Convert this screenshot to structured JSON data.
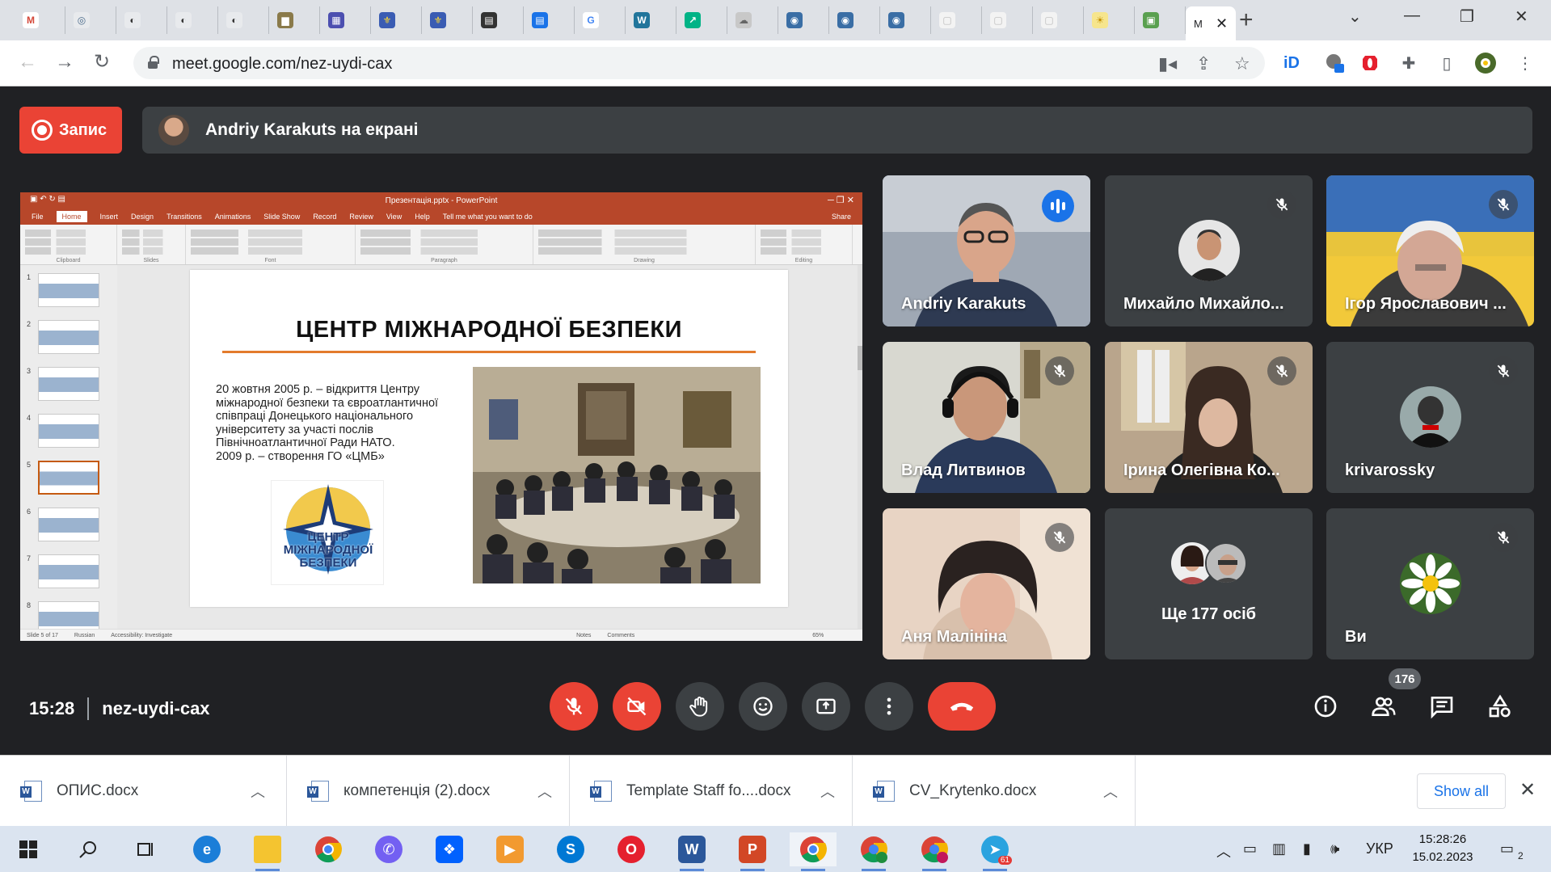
{
  "browser": {
    "tabs": [
      {
        "short": "M",
        "color": "#fff",
        "text": "",
        "fg": "#d44638"
      },
      {
        "short": "◎",
        "color": "#e8eaed",
        "text": "",
        "fg": "#4a6a8a"
      },
      {
        "short": "◐",
        "color": "#e8eaed",
        "text": "",
        "fg": "#333"
      },
      {
        "short": "◐",
        "color": "#e8eaed",
        "text": "",
        "fg": "#333"
      },
      {
        "short": "◐",
        "color": "#e8eaed",
        "text": "",
        "fg": "#333"
      },
      {
        "short": "▆",
        "color": "#8a7a4a",
        "text": "",
        "fg": "#fff"
      },
      {
        "short": "▦",
        "color": "#4c4fb0",
        "text": "",
        "fg": "#fff"
      },
      {
        "short": "⚜",
        "color": "#3a5cb3",
        "text": "",
        "fg": "#fdd835"
      },
      {
        "short": "⚜",
        "color": "#3a5cb3",
        "text": "",
        "fg": "#fdd835"
      },
      {
        "short": "▤",
        "color": "#333",
        "text": "",
        "fg": "#fff"
      },
      {
        "short": "▤",
        "color": "#1a73e8",
        "text": "",
        "fg": "#fff"
      },
      {
        "short": "G",
        "color": "#fff",
        "text": "",
        "fg": "#4285f4"
      },
      {
        "short": "W",
        "color": "#21759b",
        "text": "",
        "fg": "#fff"
      },
      {
        "short": "↗",
        "color": "#00b386",
        "text": "",
        "fg": "#fff"
      },
      {
        "short": "☁",
        "color": "#c8c8c8",
        "text": "",
        "fg": "#666"
      },
      {
        "short": "◉",
        "color": "#3a6ea5",
        "text": "",
        "fg": "#fff"
      },
      {
        "short": "◉",
        "color": "#3a6ea5",
        "text": "",
        "fg": "#fff"
      },
      {
        "short": "◉",
        "color": "#3a6ea5",
        "text": "",
        "fg": "#fff"
      },
      {
        "short": "▢",
        "color": "#f3f3f3",
        "text": "",
        "fg": "#bbb"
      },
      {
        "short": "▢",
        "color": "#f3f3f3",
        "text": "",
        "fg": "#bbb"
      },
      {
        "short": "▢",
        "color": "#f3f3f3",
        "text": "",
        "fg": "#bbb"
      },
      {
        "short": "☀",
        "color": "#f6e58d",
        "text": "",
        "fg": "#c49000"
      },
      {
        "short": "▣",
        "color": "#5aa050",
        "text": "",
        "fg": "#fff"
      }
    ],
    "active_tab": {
      "label": "M",
      "close": "✕"
    },
    "new_tab": "+",
    "url": "meet.google.com/nez-uydi-cax"
  },
  "meet": {
    "record_label": "Запис",
    "presenting_text": "Andriy Karakuts на екрані",
    "time": "15:28",
    "meeting_code": "nez-uydi-cax",
    "people_count": "176",
    "colors": {
      "red": "#ea4335",
      "dark": "#202124",
      "tile": "#3c4043",
      "accent": "#8ab4f8"
    }
  },
  "slide": {
    "title": "ЦЕНТР МІЖНАРОДНОЇ БЕЗПЕКИ",
    "text1": "20 жовтня 2005 р. – відкриття Центру міжнародної безпеки та євроатлантичної співпраці Донецького національного університету за участі послів Північноатлантичної Ради НАТО.",
    "text2": "2009 р. – створення ГО «ЦМБ»",
    "logo_text": "ЦЕНТР МІЖНАРОДНОЇ БЕЗПЕКИ",
    "pp_title": "Презентація.pptx - PowerPoint",
    "pp_menu": [
      "File",
      "Home",
      "Insert",
      "Design",
      "Transitions",
      "Animations",
      "Slide Show",
      "Record",
      "Review",
      "View",
      "Help",
      "Tell me what you want to do"
    ],
    "pp_share": "Share",
    "ribbon": [
      "Clipboard",
      "Slides",
      "Font",
      "Paragraph",
      "Drawing",
      "Editing"
    ],
    "status_left": "Slide 5 of 17",
    "status_lang": "Russian",
    "status_access": "Accessibility: Investigate",
    "status_notes": "Notes",
    "status_comments": "Comments",
    "status_zoom": "65%"
  },
  "participants": [
    {
      "name": "Andriy Karakuts",
      "state": "speaking"
    },
    {
      "name": "Михайло Михайло...",
      "state": "muted"
    },
    {
      "name": "Ігор Ярославович ...",
      "state": "muted"
    },
    {
      "name": "Влад Литвинов",
      "state": "muted"
    },
    {
      "name": "Ірина Олегівна Ко...",
      "state": "muted"
    },
    {
      "name": "krivarossky",
      "state": "muted"
    },
    {
      "name": "Аня Малініна",
      "state": "muted"
    },
    {
      "name": "Ще 177 осіб",
      "state": "more"
    },
    {
      "name": "Ви",
      "state": "muted"
    }
  ],
  "downloads": [
    {
      "name": "ОПИС.docx"
    },
    {
      "name": "компетенція (2).docx"
    },
    {
      "name": "Template Staff fo....docx"
    },
    {
      "name": "CV_Krytenko.docx"
    }
  ],
  "downloads_show_all": "Show all",
  "taskbar": {
    "time": "15:28:26",
    "date": "15.02.2023",
    "lang": "УКР",
    "notif": "2",
    "telegram_badge": "61"
  }
}
